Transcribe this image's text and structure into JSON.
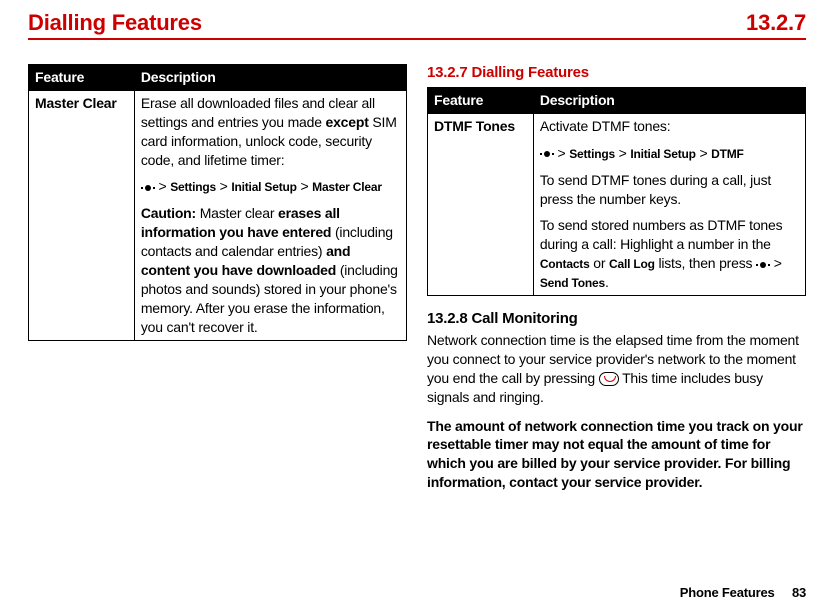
{
  "header": {
    "title": "Dialling Features",
    "section": "13.2.7"
  },
  "left_table": {
    "headers": [
      "Feature",
      "Description"
    ],
    "feature": "Master Clear",
    "desc": {
      "p1a": "Erase all downloaded files and clear all settings and entries you made ",
      "p1b": "except",
      "p1c": " SIM card information, unlock code, security code, and lifetime timer:",
      "nav": {
        "a": "Settings",
        "b": "Initial Setup",
        "c": "Master Clear"
      },
      "p3a": "Caution:",
      "p3b": " Master clear ",
      "p3c": "erases all information you have entered",
      "p3d": " (including contacts and calendar entries) ",
      "p3e": "and content you have downloaded",
      "p3f": " (including photos and sounds) stored in your phone's memory. After you erase the information, you can't recover it."
    }
  },
  "right": {
    "h1": "13.2.7 Dialling Features",
    "table": {
      "headers": [
        "Feature",
        "Description"
      ],
      "feature": "DTMF Tones",
      "desc": {
        "p1": "Activate DTMF tones:",
        "nav": {
          "a": "Settings",
          "b": "Initial Setup",
          "c": "DTMF"
        },
        "p2": "To send DTMF tones during a call, just press the number keys.",
        "p3a": "To send stored numbers as DTMF tones during a call: Highlight a number in the ",
        "p3b": "Contacts",
        "p3c": " or ",
        "p3d": "Call Log",
        "p3e": " lists, then press ",
        "p3f": "Send Tones",
        "p3g": "."
      }
    },
    "h2": "13.2.8 Call Monitoring",
    "body1a": "Network connection time is the elapsed time from the moment you connect to your service provider's network to the moment you end the call by pressing ",
    "body1b": "  This time includes busy signals and ringing.",
    "body2": "The amount of network connection time you track on your resettable timer may not equal the amount of time for which you are billed by your service provider. For billing information, contact your service provider."
  },
  "footer": {
    "label": "Phone Features",
    "page": "83"
  },
  "glyphs": {
    "gt": ">"
  }
}
